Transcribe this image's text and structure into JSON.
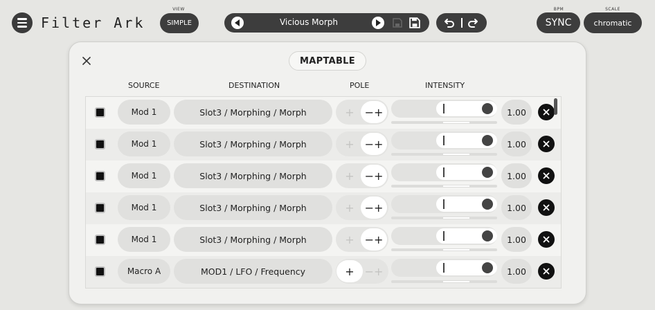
{
  "app": {
    "title": "Filter Ark",
    "view_label": "VIEW",
    "view_mode": "SIMPLE",
    "preset_name": "Vicious Morph",
    "bpm_label": "BPM",
    "sync_label": "SYNC",
    "scale_label": "SCALE",
    "scale_value": "chromatic"
  },
  "maptable": {
    "title": "MAPTABLE",
    "columns": {
      "source": "SOURCE",
      "destination": "DESTINATION",
      "pole": "POLE",
      "intensity": "INTENSITY"
    },
    "rows": [
      {
        "source": "Mod 1",
        "destination": "Slot3 / Morphing / Morph",
        "pole": "bipolar",
        "intensity": 1.0,
        "value": "1.00"
      },
      {
        "source": "Mod 1",
        "destination": "Slot3 / Morphing / Morph",
        "pole": "bipolar",
        "intensity": 1.0,
        "value": "1.00"
      },
      {
        "source": "Mod 1",
        "destination": "Slot3 / Morphing / Morph",
        "pole": "bipolar",
        "intensity": 1.0,
        "value": "1.00"
      },
      {
        "source": "Mod 1",
        "destination": "Slot3 / Morphing / Morph",
        "pole": "bipolar",
        "intensity": 1.0,
        "value": "1.00"
      },
      {
        "source": "Mod 1",
        "destination": "Slot3 / Morphing / Morph",
        "pole": "bipolar",
        "intensity": 1.0,
        "value": "1.00"
      },
      {
        "source": "Macro A",
        "destination": "MOD1 / LFO / Frequency",
        "pole": "unipolar",
        "intensity": 1.0,
        "value": "1.00"
      }
    ]
  },
  "pole_glyphs": {
    "unipolar": "+",
    "bipolar": "−+"
  },
  "icons": {
    "menu": "hamburger-icon",
    "prev": "triangle-left-icon",
    "next": "triangle-right-icon",
    "save": "floppy-disk-icon",
    "undo": "undo-arrow-icon",
    "redo": "redo-arrow-icon",
    "close": "x-icon",
    "remove": "x-circle-icon"
  },
  "colors": {
    "dark_control": "#3d3d3d",
    "panel_bg": "#f1f1ef",
    "page_bg": "#e6e6e3"
  }
}
